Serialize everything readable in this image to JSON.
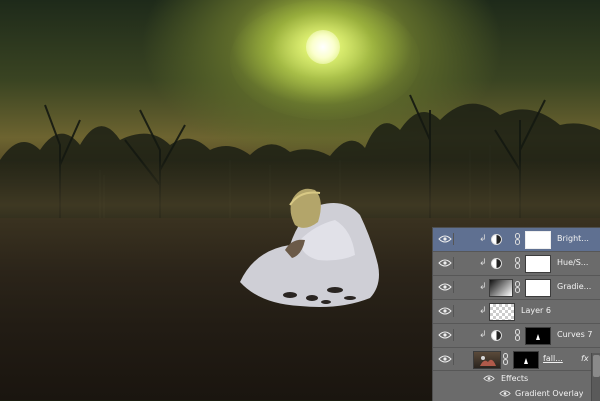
{
  "image": {
    "description_colors": {
      "sky_glow": "#d9e870",
      "ground": "#2b2419",
      "dress": "#d8d8e0",
      "panel_bg": "#6b6b6b",
      "selected_row": "#5f7091"
    }
  },
  "layers_panel": {
    "layers": [
      {
        "name": "Bright...",
        "icon": "adjustment-icon",
        "selected": true,
        "clipped": true,
        "mask": "white"
      },
      {
        "name": "Hue/S...",
        "icon": "adjustment-icon",
        "selected": false,
        "clipped": true,
        "mask": "white"
      },
      {
        "name": "Gradie...",
        "icon": "gradient-icon",
        "selected": false,
        "clipped": true,
        "mask": "white"
      },
      {
        "name": "Layer 6",
        "icon": "transparent-thumbnail",
        "selected": false,
        "clipped": true,
        "mask": ""
      },
      {
        "name": "Curves 7",
        "icon": "adjustment-icon",
        "selected": false,
        "clipped": true,
        "mask": "black"
      },
      {
        "name": "fall...",
        "icon": "photo-thumbnail",
        "selected": false,
        "clipped": false,
        "mask": "black",
        "fx": "fx"
      }
    ],
    "effects_label": "Effects",
    "gradient_overlay_label": "Gradient Overlay"
  }
}
